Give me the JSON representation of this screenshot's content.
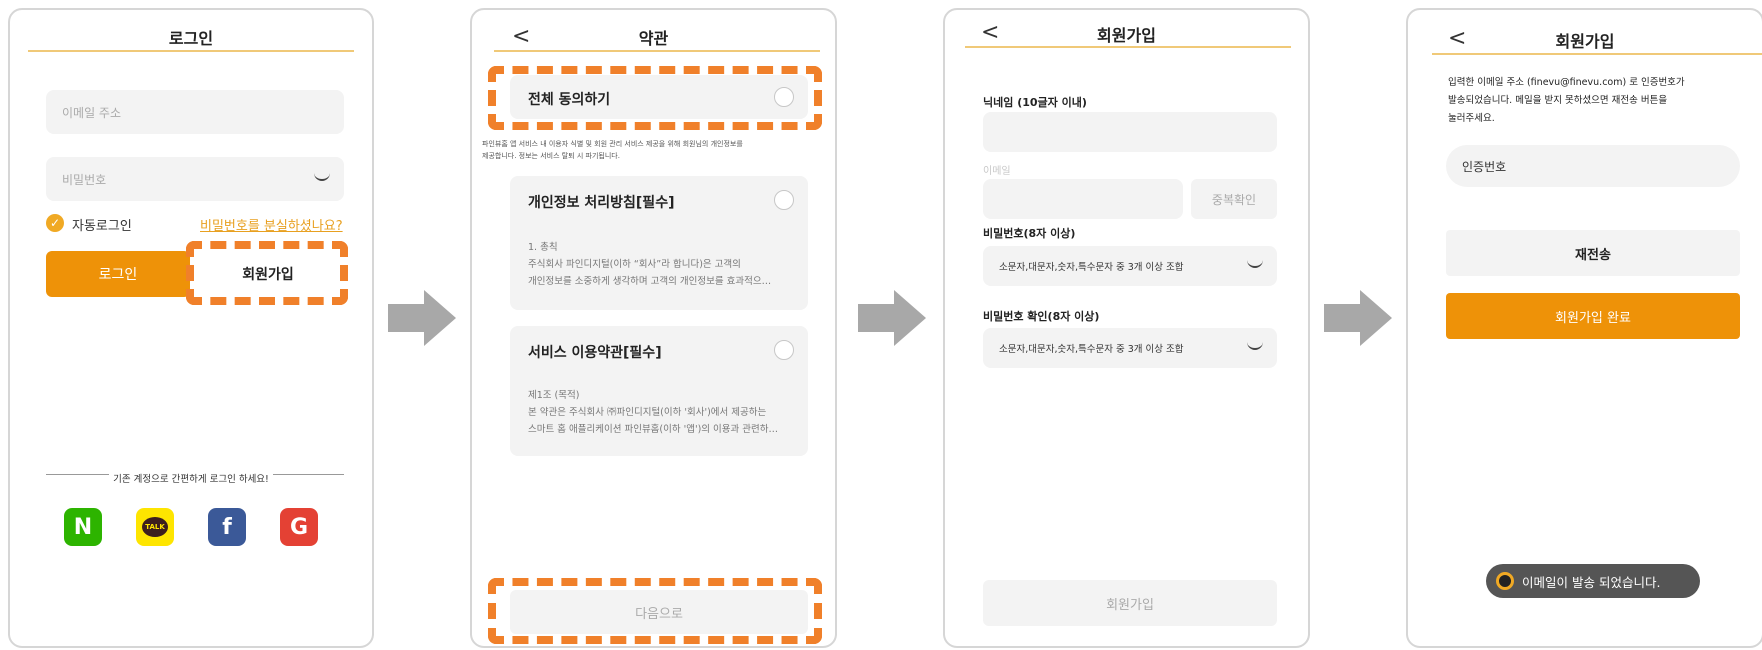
{
  "screen1": {
    "title": "로그인",
    "email_placeholder": "이메일 주소",
    "password_placeholder": "비밀번호",
    "auto_login": "자동로그인",
    "forgot_password": "비밀번호를 분실하셨나요?",
    "login_button": "로그인",
    "signup_button": "회원가입",
    "social_divider": "기존 계정으로 간편하게 로그인 하세요!",
    "social": [
      {
        "letter": "N",
        "name": "naver",
        "color": "#2db400"
      },
      {
        "letter": "TALK",
        "name": "kakao",
        "color": "#fee500"
      },
      {
        "letter": "f",
        "name": "facebook",
        "color": "#3b5998"
      },
      {
        "letter": "G",
        "name": "google",
        "color": "#e44134"
      }
    ]
  },
  "screen2": {
    "title": "약관",
    "back": "<",
    "agree_all": "전체 동의하기",
    "intro_line1": "파인뷰홈 앱 서비스 내 이용자 식별 및 회원 관리 서비스 제공을 위해 회원님의 개인정보를",
    "intro_line2": "제공합니다. 정보는 서비스 탈퇴 시 파기됩니다.",
    "privacy_title": "개인정보 처리방침[필수]",
    "privacy_line1": "1. 총칙",
    "privacy_line2": "주식회사 파인디지털(이하 “회사”라 합니다)은 고객의",
    "privacy_line3": "개인정보를 소중하게 생각하며 고객의 개인정보를 효과적으…",
    "terms_title": "서비스 이용약관[필수]",
    "terms_line1": "제1조 (목적)",
    "terms_line2": "본 약관은 주식회사 ㈜파인디지털(이하 '회사')에서 제공하는",
    "terms_line3": "스마트 홈 애플리케이션 파인뷰홈(이하 '앱')의 이용과 관련하…",
    "next_button": "다음으로"
  },
  "screen3": {
    "title": "회원가입",
    "back": "<",
    "nickname_label": "닉네임 (10글자 이내)",
    "email_label": "이메일",
    "duplicate_check": "중복확인",
    "password_label": "비밀번호(8자 이상)",
    "password_placeholder": "소문자,대문자,숫자,특수문자 중 3개 이상 조합",
    "confirm_label": "비밀번호 확인(8자 이상)",
    "confirm_placeholder": "소문자,대문자,숫자,특수문자 중 3개 이상 조합",
    "signup_button": "회원가입"
  },
  "screen4": {
    "title": "회원가입",
    "back": "<",
    "message_line1": "입력한 이메일 주소 (finevu@finevu.com) 로 인증번호가",
    "message_line2": "발송되었습니다. 메일을 받지 못하셨으면 재전송 버튼을",
    "message_line3": "눌러주세요.",
    "code_placeholder": "인증번호",
    "resend_button": "재전송",
    "complete_button": "회원가입 완료",
    "toast": "이메일이 발송 되었습니다."
  },
  "colors": {
    "accent": "#ee9208",
    "highlight_dash": "#f0802a",
    "header_line": "#f0c978",
    "field_bg": "#f3f3f3",
    "arrow": "#a8a8a8",
    "toast_bg": "#555555"
  }
}
